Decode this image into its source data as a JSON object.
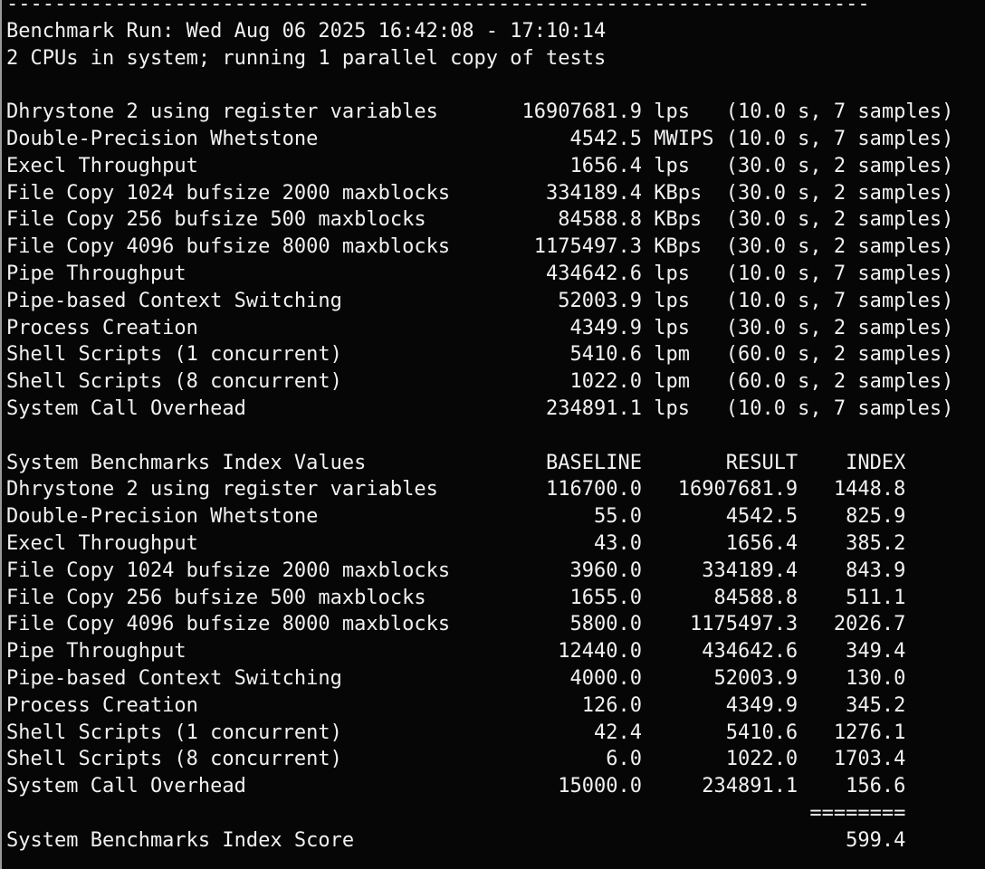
{
  "terminal": {
    "colors": {
      "background": "#060606",
      "text": "#f1f1f1",
      "window_edge": "#9a9a9a"
    },
    "separator": {
      "char": "-",
      "count": 72
    },
    "run_line": "Benchmark Run: Wed Aug 06 2025 16:42:08 - 17:10:14",
    "cpu_line": "2 CPUs in system; running 1 parallel copy of tests",
    "results": [
      {
        "name": "Dhrystone 2 using register variables",
        "value": "16907681.9",
        "unit": "lps",
        "detail": "(10.0 s, 7 samples)"
      },
      {
        "name": "Double-Precision Whetstone",
        "value": "4542.5",
        "unit": "MWIPS",
        "detail": "(10.0 s, 7 samples)"
      },
      {
        "name": "Execl Throughput",
        "value": "1656.4",
        "unit": "lps",
        "detail": "(30.0 s, 2 samples)"
      },
      {
        "name": "File Copy 1024 bufsize 2000 maxblocks",
        "value": "334189.4",
        "unit": "KBps",
        "detail": "(30.0 s, 2 samples)"
      },
      {
        "name": "File Copy 256 bufsize 500 maxblocks",
        "value": "84588.8",
        "unit": "KBps",
        "detail": "(30.0 s, 2 samples)"
      },
      {
        "name": "File Copy 4096 bufsize 8000 maxblocks",
        "value": "1175497.3",
        "unit": "KBps",
        "detail": "(30.0 s, 2 samples)"
      },
      {
        "name": "Pipe Throughput",
        "value": "434642.6",
        "unit": "lps",
        "detail": "(10.0 s, 7 samples)"
      },
      {
        "name": "Pipe-based Context Switching",
        "value": "52003.9",
        "unit": "lps",
        "detail": "(10.0 s, 7 samples)"
      },
      {
        "name": "Process Creation",
        "value": "4349.9",
        "unit": "lps",
        "detail": "(30.0 s, 2 samples)"
      },
      {
        "name": "Shell Scripts (1 concurrent)",
        "value": "5410.6",
        "unit": "lpm",
        "detail": "(60.0 s, 2 samples)"
      },
      {
        "name": "Shell Scripts (8 concurrent)",
        "value": "1022.0",
        "unit": "lpm",
        "detail": "(60.0 s, 2 samples)"
      },
      {
        "name": "System Call Overhead",
        "value": "234891.1",
        "unit": "lps",
        "detail": "(10.0 s, 7 samples)"
      }
    ],
    "index_table": {
      "title": "System Benchmarks Index Values",
      "col_baseline": "BASELINE",
      "col_result": "RESULT",
      "col_index": "INDEX",
      "rows": [
        {
          "name": "Dhrystone 2 using register variables",
          "baseline": "116700.0",
          "result": "16907681.9",
          "index": "1448.8"
        },
        {
          "name": "Double-Precision Whetstone",
          "baseline": "55.0",
          "result": "4542.5",
          "index": "825.9"
        },
        {
          "name": "Execl Throughput",
          "baseline": "43.0",
          "result": "1656.4",
          "index": "385.2"
        },
        {
          "name": "File Copy 1024 bufsize 2000 maxblocks",
          "baseline": "3960.0",
          "result": "334189.4",
          "index": "843.9"
        },
        {
          "name": "File Copy 256 bufsize 500 maxblocks",
          "baseline": "1655.0",
          "result": "84588.8",
          "index": "511.1"
        },
        {
          "name": "File Copy 4096 bufsize 8000 maxblocks",
          "baseline": "5800.0",
          "result": "1175497.3",
          "index": "2026.7"
        },
        {
          "name": "Pipe Throughput",
          "baseline": "12440.0",
          "result": "434642.6",
          "index": "349.4"
        },
        {
          "name": "Pipe-based Context Switching",
          "baseline": "4000.0",
          "result": "52003.9",
          "index": "130.0"
        },
        {
          "name": "Process Creation",
          "baseline": "126.0",
          "result": "4349.9",
          "index": "345.2"
        },
        {
          "name": "Shell Scripts (1 concurrent)",
          "baseline": "42.4",
          "result": "5410.6",
          "index": "1276.1"
        },
        {
          "name": "Shell Scripts (8 concurrent)",
          "baseline": "6.0",
          "result": "1022.0",
          "index": "1703.4"
        },
        {
          "name": "System Call Overhead",
          "baseline": "15000.0",
          "result": "234891.1",
          "index": "156.6"
        }
      ],
      "rule": "========",
      "score_label": "System Benchmarks Index Score",
      "score": "599.4"
    }
  }
}
